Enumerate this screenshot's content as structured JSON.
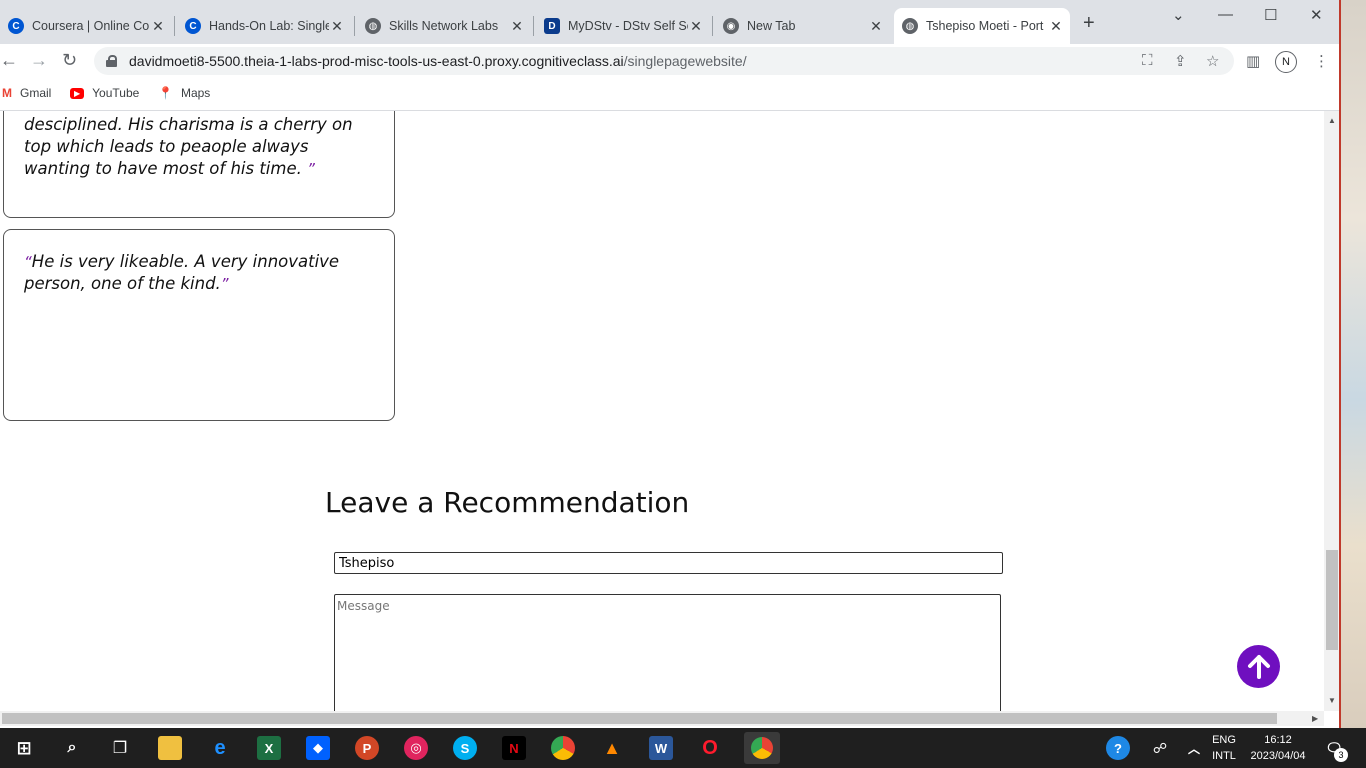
{
  "browser": {
    "tabs": [
      {
        "title": "Coursera | Online Cou",
        "favicon": "coursera-icon"
      },
      {
        "title": "Hands-On Lab: Single",
        "favicon": "coursera-icon"
      },
      {
        "title": "Skills Network Labs",
        "favicon": "globe-icon"
      },
      {
        "title": "MyDStv - DStv Self Se",
        "favicon": "dstv-icon"
      },
      {
        "title": "New Tab",
        "favicon": "chrome-icon"
      },
      {
        "title": "Tshepiso Moeti - Port",
        "favicon": "globe-icon",
        "active": true
      }
    ],
    "url_host": "davidmoeti8-5500.theia-1-labs-prod-misc-tools-us-east-0.proxy.cognitiveclass.ai",
    "url_path": "/singlepagewebsite/",
    "profile_initial": "N",
    "bookmarks": [
      {
        "label": "Gmail",
        "icon": "gmail-icon"
      },
      {
        "label": "YouTube",
        "icon": "youtube-icon"
      },
      {
        "label": "Maps",
        "icon": "maps-icon"
      }
    ]
  },
  "page": {
    "recommendations": [
      {
        "text": "desciplined. His charisma is a cherry on top which leads to peaople always wanting to have most of his time. "
      },
      {
        "text": "He is very likeable. A very innovative person, one of the kind."
      }
    ],
    "section_title": "Leave a Recommendation",
    "name_value": "Tshepiso",
    "message_placeholder": "Message",
    "accent_color": "#6f0fbf"
  },
  "taskbar": {
    "lang_line1": "ENG",
    "lang_line2": "INTL",
    "time": "16:12",
    "date": "2023/04/04",
    "notification_count": "3"
  }
}
